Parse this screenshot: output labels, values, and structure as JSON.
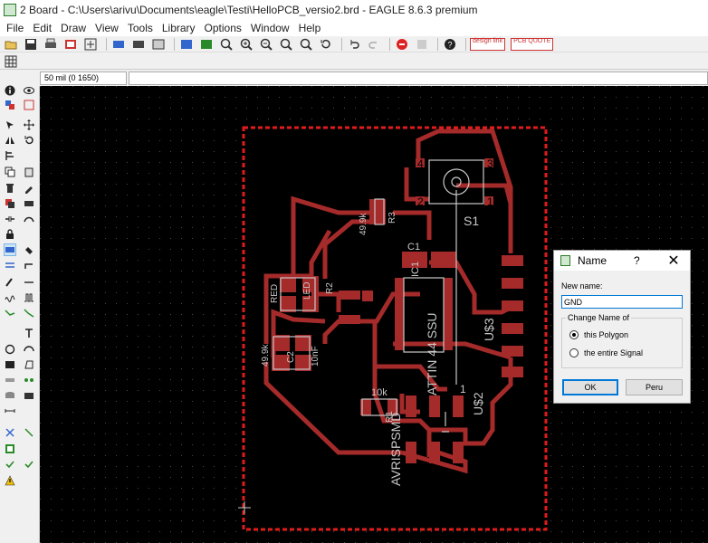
{
  "window": {
    "title": "2 Board - C:\\Users\\arivu\\Documents\\eagle\\Testi\\HelloPCB_versio2.brd - EAGLE 8.6.3 premium"
  },
  "menu": [
    "File",
    "Edit",
    "Draw",
    "View",
    "Tools",
    "Library",
    "Options",
    "Window",
    "Help"
  ],
  "toolbar": {
    "brand1": "design link",
    "brand2": "PCB QUOTE"
  },
  "status": {
    "grid": "50 mil (0 1650)"
  },
  "board": {
    "colors": {
      "background": "#000000",
      "copper": "#a52a2a",
      "outline": "#e01b1b",
      "silk": "#c8c8c8",
      "grid": "#3a3a3a"
    },
    "labels": {
      "pin4": "4",
      "pin3": "3",
      "pin2": "2",
      "pin1": "1",
      "s1": "S1",
      "r3val": "49.9k",
      "r3": "R3",
      "c1": "C1",
      "ic1": "IC1",
      "red": "RED",
      "r2": "R2",
      "led": "LED",
      "r1val": "49.9k",
      "c2": "C2",
      "cval": "10nF",
      "attiny": "ATTIN 44 SSU",
      "u3": "U$3",
      "u2": "U$2",
      "one": "1",
      "r1": "R1",
      "k10": "10k",
      "avr": "AVRISPSMD"
    }
  },
  "dialog": {
    "title": "Name",
    "help": "?",
    "close": "✕",
    "new_name_label": "New name:",
    "new_name_value": "GND",
    "group_label": "Change Name of",
    "option_polygon": "this Polygon",
    "option_signal": "the entire Signal",
    "ok_label": "OK",
    "cancel_label": "Peru"
  }
}
